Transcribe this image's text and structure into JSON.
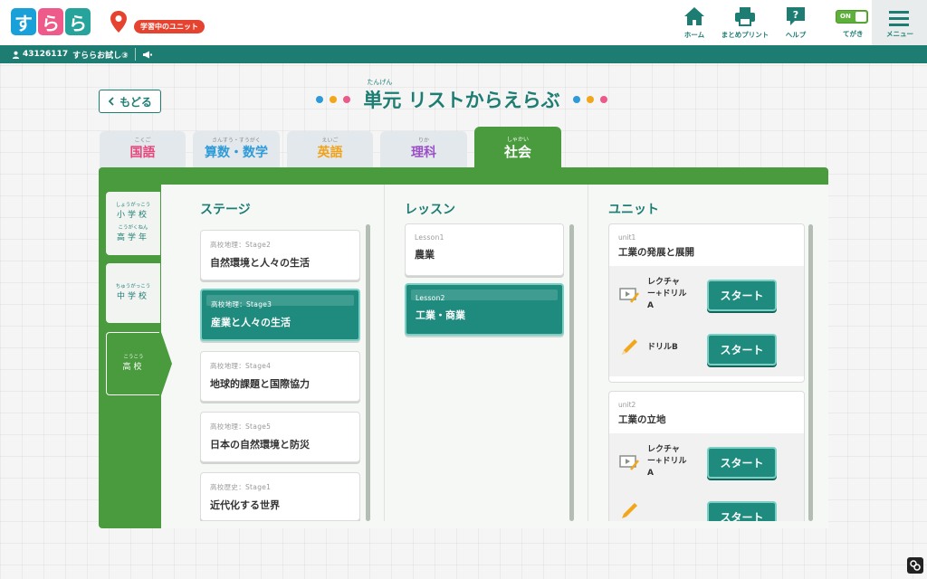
{
  "logo": {
    "chars": [
      "す",
      "ら",
      "ら"
    ],
    "colors": [
      "#1aa0d8",
      "#ee5a8a",
      "#26a39a"
    ]
  },
  "header": {
    "unit_badge": "学習中のユニット",
    "nav": {
      "home": "ホーム",
      "print": "まとめプリント",
      "help": "ヘルプ",
      "handwriting": "てがき",
      "menu": "メニュー"
    },
    "toggle_state": "ON"
  },
  "subbar": {
    "user_id": "43126117",
    "user_name": "すららお試し③"
  },
  "page": {
    "back_label": "もどる",
    "title": "単元 リストからえらぶ",
    "title_ruby": "たんげん",
    "dot_colors": [
      "#2e9bd8",
      "#f2a61a",
      "#ec5a8a"
    ]
  },
  "subjects": [
    {
      "ruby": "こくご",
      "name": "国語",
      "color": "#e8457a"
    },
    {
      "ruby": "さんすう・すうがく",
      "name": "算数・数学",
      "color": "#2e9bd8"
    },
    {
      "ruby": "えいご",
      "name": "英語",
      "color": "#f0a218"
    },
    {
      "ruby": "りか",
      "name": "理科",
      "color": "#9b4fc6"
    },
    {
      "ruby": "しゃかい",
      "name": "社会",
      "color": "#ffffff",
      "active": true
    }
  ],
  "levels": {
    "elementary": {
      "ruby1": "しょうがっこう",
      "label1": "小学校",
      "ruby2": "こうがくねん",
      "label2": "高学年"
    },
    "middle": {
      "ruby": "ちゅうがっこう",
      "label": "中学校"
    },
    "high": {
      "ruby": "こうこう",
      "label": "高校"
    }
  },
  "columns": {
    "stage": "ステージ",
    "lesson": "レッスン",
    "unit": "ユニット"
  },
  "stages": [
    {
      "sub": "高校地理：Stage2",
      "title": "自然環境と人々の生活"
    },
    {
      "sub": "高校地理：Stage3",
      "title": "産業と人々の生活",
      "selected": true
    },
    {
      "sub": "高校地理：Stage4",
      "title": "地球的課題と国際協力"
    },
    {
      "sub": "高校地理：Stage5",
      "title": "日本の自然環境と防災"
    },
    {
      "sub": "高校歴史：Stage1",
      "title": "近代化する世界"
    }
  ],
  "lessons": [
    {
      "sub": "Lesson1",
      "title": "農業"
    },
    {
      "sub": "Lesson2",
      "title": "工業・商業",
      "selected": true
    }
  ],
  "units": [
    {
      "sub": "unit1",
      "title": "工業の発展と展開",
      "activities": [
        {
          "label_l1": "レクチャ",
          "label_l2": "ー+ドリル",
          "label_l3": "A",
          "start": "スタート"
        },
        {
          "label_l1": "ドリルB",
          "start": "スタート"
        }
      ]
    },
    {
      "sub": "unit2",
      "title": "工業の立地",
      "activities": [
        {
          "label_l1": "レクチャ",
          "label_l2": "ー+ドリル",
          "label_l3": "A",
          "start": "スタート"
        },
        {
          "label_l1": "",
          "start": "スタート"
        }
      ]
    }
  ]
}
